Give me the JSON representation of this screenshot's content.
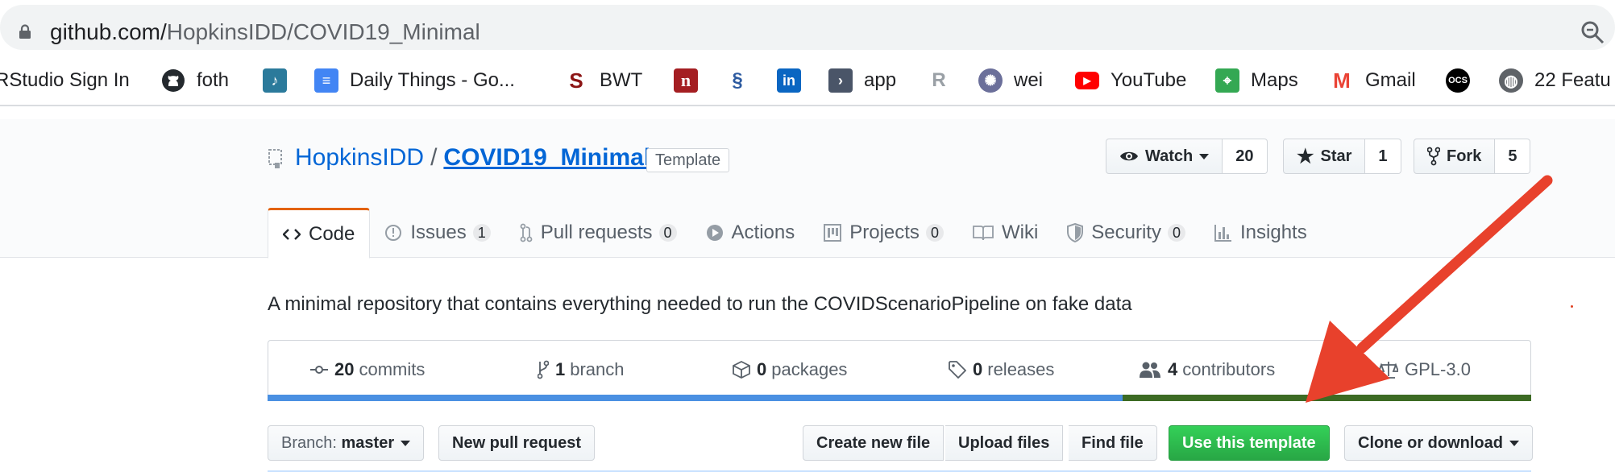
{
  "browser": {
    "url_host": "github.com/",
    "url_path": "HopkinsIDD/COVID19_Minimal",
    "bookmarks": [
      {
        "label": "RStudio Sign In",
        "icon": "none"
      },
      {
        "label": "foth",
        "icon": "github-icon"
      },
      {
        "label": "",
        "icon": "music-icon"
      },
      {
        "label": "Daily Things - Go...",
        "icon": "docs-icon"
      },
      {
        "label": "BWT",
        "icon": "stanford-icon"
      },
      {
        "label": "",
        "icon": "n-icon"
      },
      {
        "label": "",
        "icon": "dna-icon"
      },
      {
        "label": "",
        "icon": "linkedin-icon"
      },
      {
        "label": "app",
        "icon": "app-icon"
      },
      {
        "label": "",
        "icon": "r-icon"
      },
      {
        "label": "wei",
        "icon": "seal-icon"
      },
      {
        "label": "YouTube",
        "icon": "youtube-icon"
      },
      {
        "label": "Maps",
        "icon": "maps-icon"
      },
      {
        "label": "Gmail",
        "icon": "gmail-icon"
      },
      {
        "label": "",
        "icon": "ocs-icon"
      },
      {
        "label": "22 Featu",
        "icon": "globe-icon"
      }
    ],
    "ocs_text": "OCS"
  },
  "repo": {
    "owner": "HopkinsIDD",
    "separator": "/",
    "name": "COVID19_Minimal",
    "badge": "Template",
    "watch_label": "Watch",
    "watch_count": "20",
    "star_label": "Star",
    "star_count": "1",
    "fork_label": "Fork",
    "fork_count": "5"
  },
  "tabs": [
    {
      "label": "Code",
      "count": ""
    },
    {
      "label": "Issues",
      "count": "1"
    },
    {
      "label": "Pull requests",
      "count": "0"
    },
    {
      "label": "Actions",
      "count": ""
    },
    {
      "label": "Projects",
      "count": "0"
    },
    {
      "label": "Wiki",
      "count": ""
    },
    {
      "label": "Security",
      "count": "0"
    },
    {
      "label": "Insights",
      "count": ""
    }
  ],
  "description": "A minimal repository that contains everything needed to run the COVIDScenarioPipeline on fake data",
  "summary": [
    {
      "value": "20",
      "label": "commits"
    },
    {
      "value": "1",
      "label": "branch"
    },
    {
      "value": "0",
      "label": "packages"
    },
    {
      "value": "0",
      "label": "releases"
    },
    {
      "value": "4",
      "label": "contributors"
    },
    {
      "value": "",
      "label": "GPL-3.0"
    }
  ],
  "filenav": {
    "branch_prefix": "Branch:",
    "branch_name": "master",
    "new_pr": "New pull request",
    "create_file": "Create new file",
    "upload_files": "Upload files",
    "find_file": "Find file",
    "use_template": "Use this template",
    "clone": "Clone or download"
  },
  "colors": {
    "link": "#0366d6",
    "tab_accent": "#e36209",
    "green_button": "#28a745",
    "annotation_arrow": "#e8412c"
  }
}
